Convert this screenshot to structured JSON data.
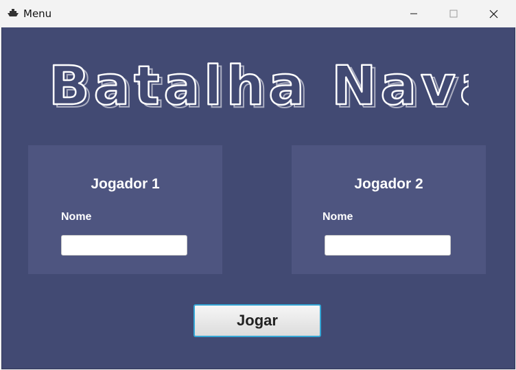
{
  "window": {
    "title": "Menu",
    "app_icon": "ship-icon",
    "controls": {
      "minimize": "minimize-icon",
      "maximize": "maximize-icon",
      "close": "close-icon"
    }
  },
  "logo": {
    "text": "Batalha Naval"
  },
  "players": [
    {
      "title": "Jogador 1",
      "name_label": "Nome",
      "name_value": ""
    },
    {
      "title": "Jogador 2",
      "name_label": "Nome",
      "name_value": ""
    }
  ],
  "play_button": {
    "label": "Jogar"
  },
  "colors": {
    "background": "#424a73",
    "panel": "#4e5580",
    "text": "#ffffff",
    "button_border": "#35a7d6"
  }
}
